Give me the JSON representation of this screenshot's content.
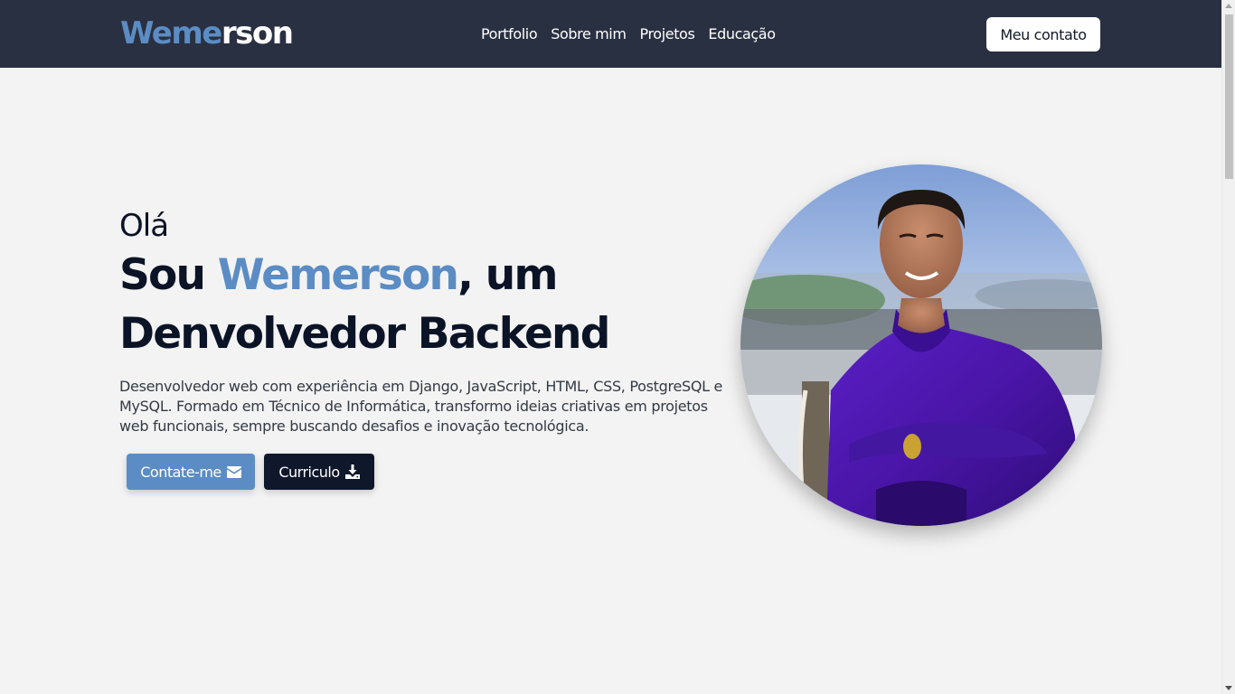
{
  "navbar": {
    "logo_part1": "Weme",
    "logo_part2": "rson",
    "links": [
      "Portfolio",
      "Sobre mim",
      "Projetos",
      "Educação"
    ],
    "contact_button": "Meu contato"
  },
  "hero": {
    "greeting": "Olá",
    "headline_prefix": "Sou ",
    "headline_name": "Wemerson",
    "headline_suffix": ", um",
    "headline_line2": "Denvolvedor Backend",
    "description": "Desenvolvedor web com experiência em Django, JavaScript, HTML, CSS, PostgreSQL e MySQL. Formado em Técnico de Informática, transformo ideias criativas em projetos web funcionais, sempre buscando desafios e inovação tecnológica.",
    "button_contact": "Contate-me",
    "button_contact_icon": "envelope-icon",
    "button_cv": "Curriculo",
    "button_cv_icon": "download-icon"
  },
  "colors": {
    "navbar_bg": "#293041",
    "accent": "#5b8cc4",
    "dark": "#0f172a",
    "page_bg": "#f3f3f3"
  }
}
